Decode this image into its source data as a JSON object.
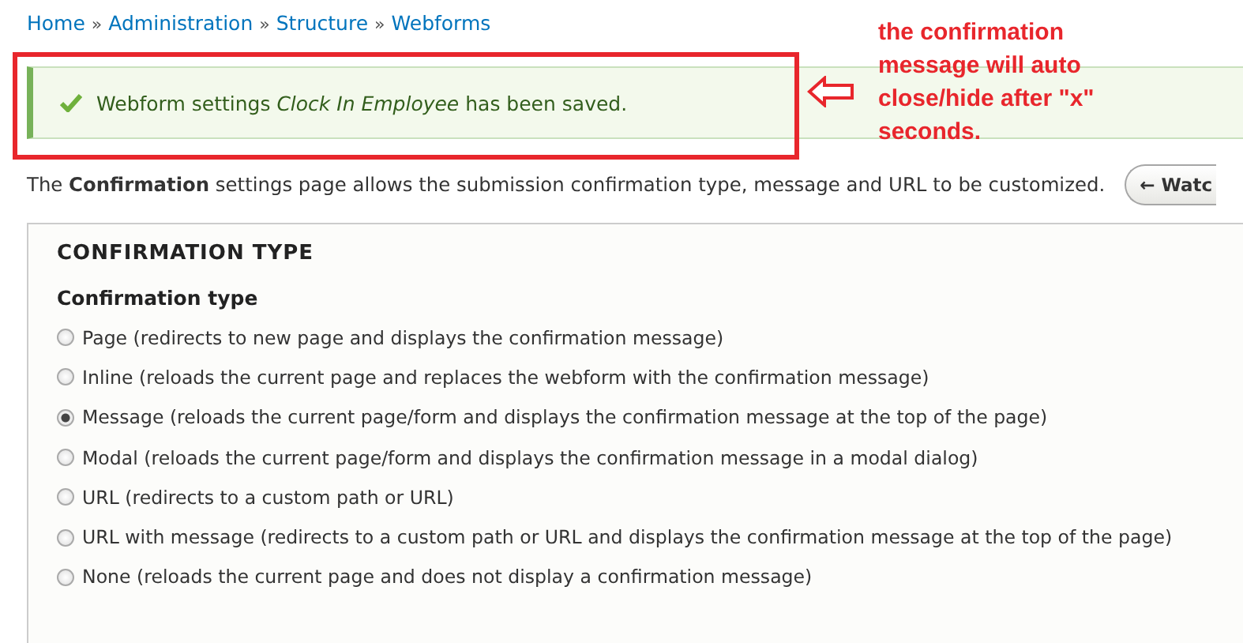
{
  "breadcrumb": {
    "separator": "»",
    "items": [
      {
        "label": "Home"
      },
      {
        "label": "Administration"
      },
      {
        "label": "Structure"
      },
      {
        "label": "Webforms"
      }
    ]
  },
  "status_message": {
    "text": "Webform settings *Clock In Employee* has been saved."
  },
  "annotation": {
    "text": "the confirmation message will auto close/hide after \"x\" seconds."
  },
  "intro": "The **Confirmation** settings page allows the submission confirmation type, message and URL to be customized.",
  "toolbar_button": {
    "label": "← Watc"
  },
  "fieldset": {
    "legend": "CONFIRMATION TYPE",
    "field_label": "Confirmation type",
    "options": [
      {
        "label": "Page (redirects to new page and displays the confirmation message)",
        "selected": false
      },
      {
        "label": "Inline (reloads the current page and replaces the webform with the confirmation message)",
        "selected": false
      },
      {
        "label": "Message (reloads the current page/form and displays the confirmation message at the top of the page)",
        "selected": true
      },
      {
        "label": "Modal (reloads the current page/form and displays the confirmation message in a modal dialog)",
        "selected": false
      },
      {
        "label": "URL (redirects to a custom path or URL)",
        "selected": false
      },
      {
        "label": "URL with message (redirects to a custom path or URL and displays the confirmation message at the top of the page)",
        "selected": false
      },
      {
        "label": "None (reloads the current page and does not display a confirmation message)",
        "selected": false
      }
    ]
  }
}
